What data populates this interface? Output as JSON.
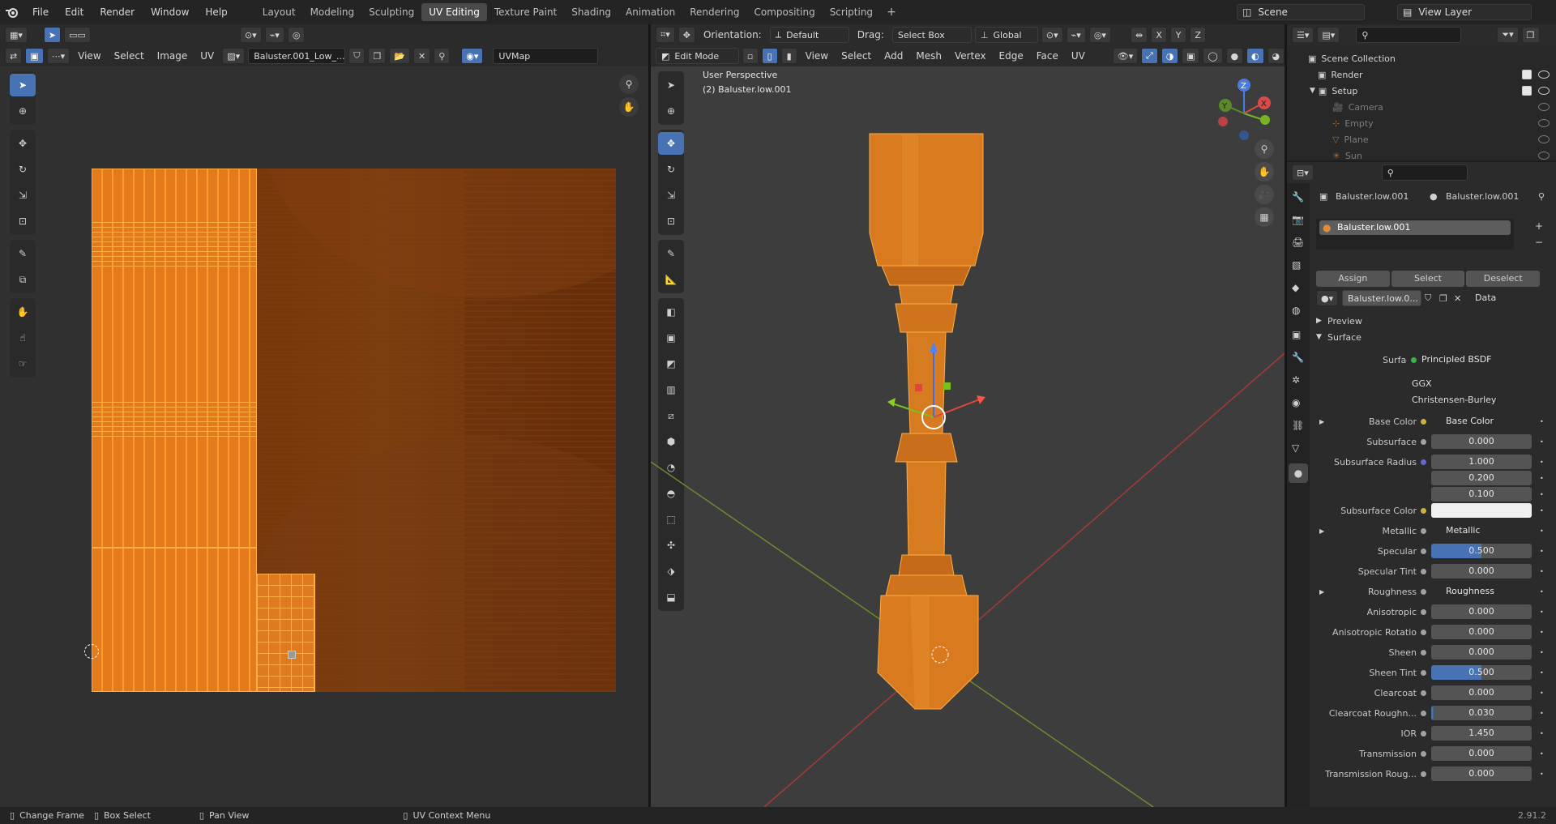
{
  "topbar": {
    "menus": [
      "File",
      "Edit",
      "Render",
      "Window",
      "Help"
    ],
    "workspaces": [
      "Layout",
      "Modeling",
      "Sculpting",
      "UV Editing",
      "Texture Paint",
      "Shading",
      "Animation",
      "Rendering",
      "Compositing",
      "Scripting"
    ],
    "active_workspace": "UV Editing",
    "add_tab": "+",
    "scene": "Scene",
    "view_layer": "View Layer"
  },
  "uv_editor": {
    "menus": [
      "View",
      "Select",
      "Image",
      "UV"
    ],
    "image_name": "Baluster.001_Low_...",
    "uv_map": "UVMap"
  },
  "viewport": {
    "mode": "Edit Mode",
    "menus": [
      "View",
      "Select",
      "Add",
      "Mesh",
      "Vertex",
      "Edge",
      "Face",
      "UV"
    ],
    "orientation_label": "Orientation:",
    "orientation_value": "Default",
    "drag_label": "Drag:",
    "drag_value": "Select Box",
    "transform_space": "Global",
    "perspective": "User Perspective",
    "object_info": "(2) Baluster.low.001",
    "axes": {
      "x": "X",
      "y": "Y",
      "z": "Z"
    }
  },
  "outliner": {
    "root": "Scene Collection",
    "items": [
      {
        "label": "Render",
        "dim": false
      },
      {
        "label": "Setup",
        "dim": false
      },
      {
        "label": "Camera",
        "dim": true
      },
      {
        "label": "Empty",
        "dim": true
      },
      {
        "label": "Plane",
        "dim": true
      },
      {
        "label": "Sun",
        "dim": true
      }
    ]
  },
  "properties": {
    "object_name": "Baluster.low.001",
    "mesh_name": "Baluster.low.001",
    "material_slot": "Baluster.low.001",
    "assign": "Assign",
    "select": "Select",
    "deselect": "Deselect",
    "material_field": "Baluster.low.0...",
    "data_dropdown": "Data",
    "preview": "Preview",
    "surface_section": "Surface",
    "surface_label": "Surface",
    "surface_value": "Principled BSDF",
    "distribution": "GGX",
    "subsurface_method": "Christensen-Burley",
    "rows": [
      {
        "label": "Base Color",
        "value": "Base Color",
        "type": "link",
        "dot": "#c7b342"
      },
      {
        "label": "Subsurface",
        "value": "0.000",
        "type": "num",
        "dot": "#a1a1a1"
      },
      {
        "label": "Subsurface Radius",
        "value": "1.000",
        "type": "num",
        "dot": "#6565d6"
      },
      {
        "label": "",
        "value": "0.200",
        "type": "num",
        "dot": ""
      },
      {
        "label": "",
        "value": "0.100",
        "type": "num",
        "dot": ""
      },
      {
        "label": "Subsurface Color",
        "value": "",
        "type": "color",
        "dot": "#c7b342"
      },
      {
        "label": "Metallic",
        "value": "Metallic",
        "type": "link",
        "dot": "#a1a1a1"
      },
      {
        "label": "Specular",
        "value": "0.500",
        "type": "bar",
        "dot": "#a1a1a1"
      },
      {
        "label": "Specular Tint",
        "value": "0.000",
        "type": "num",
        "dot": "#a1a1a1"
      },
      {
        "label": "Roughness",
        "value": "Roughness",
        "type": "link",
        "dot": "#a1a1a1"
      },
      {
        "label": "Anisotropic",
        "value": "0.000",
        "type": "num",
        "dot": "#a1a1a1"
      },
      {
        "label": "Anisotropic Rotatio",
        "value": "0.000",
        "type": "num",
        "dot": "#a1a1a1"
      },
      {
        "label": "Sheen",
        "value": "0.000",
        "type": "num",
        "dot": "#a1a1a1"
      },
      {
        "label": "Sheen Tint",
        "value": "0.500",
        "type": "bar",
        "dot": "#a1a1a1"
      },
      {
        "label": "Clearcoat",
        "value": "0.000",
        "type": "num",
        "dot": "#a1a1a1"
      },
      {
        "label": "Clearcoat Roughn...",
        "value": "0.030",
        "type": "bar2",
        "dot": "#a1a1a1"
      },
      {
        "label": "IOR",
        "value": "1.450",
        "type": "num",
        "dot": "#a1a1a1"
      },
      {
        "label": "Transmission",
        "value": "0.000",
        "type": "num",
        "dot": "#a1a1a1"
      },
      {
        "label": "Transmission Roug...",
        "value": "0.000",
        "type": "num",
        "dot": "#a1a1a1"
      }
    ]
  },
  "statusbar": {
    "change_frame": "Change Frame",
    "box_select": "Box Select",
    "pan_view": "Pan View",
    "context_menu": "UV Context Menu",
    "version": "2.91.2"
  },
  "colors": {
    "accent": "#4772b3",
    "uv_orange": "#ff9a2f",
    "wood_dark": "#6a2e08",
    "wood_mid": "#8a4410"
  }
}
